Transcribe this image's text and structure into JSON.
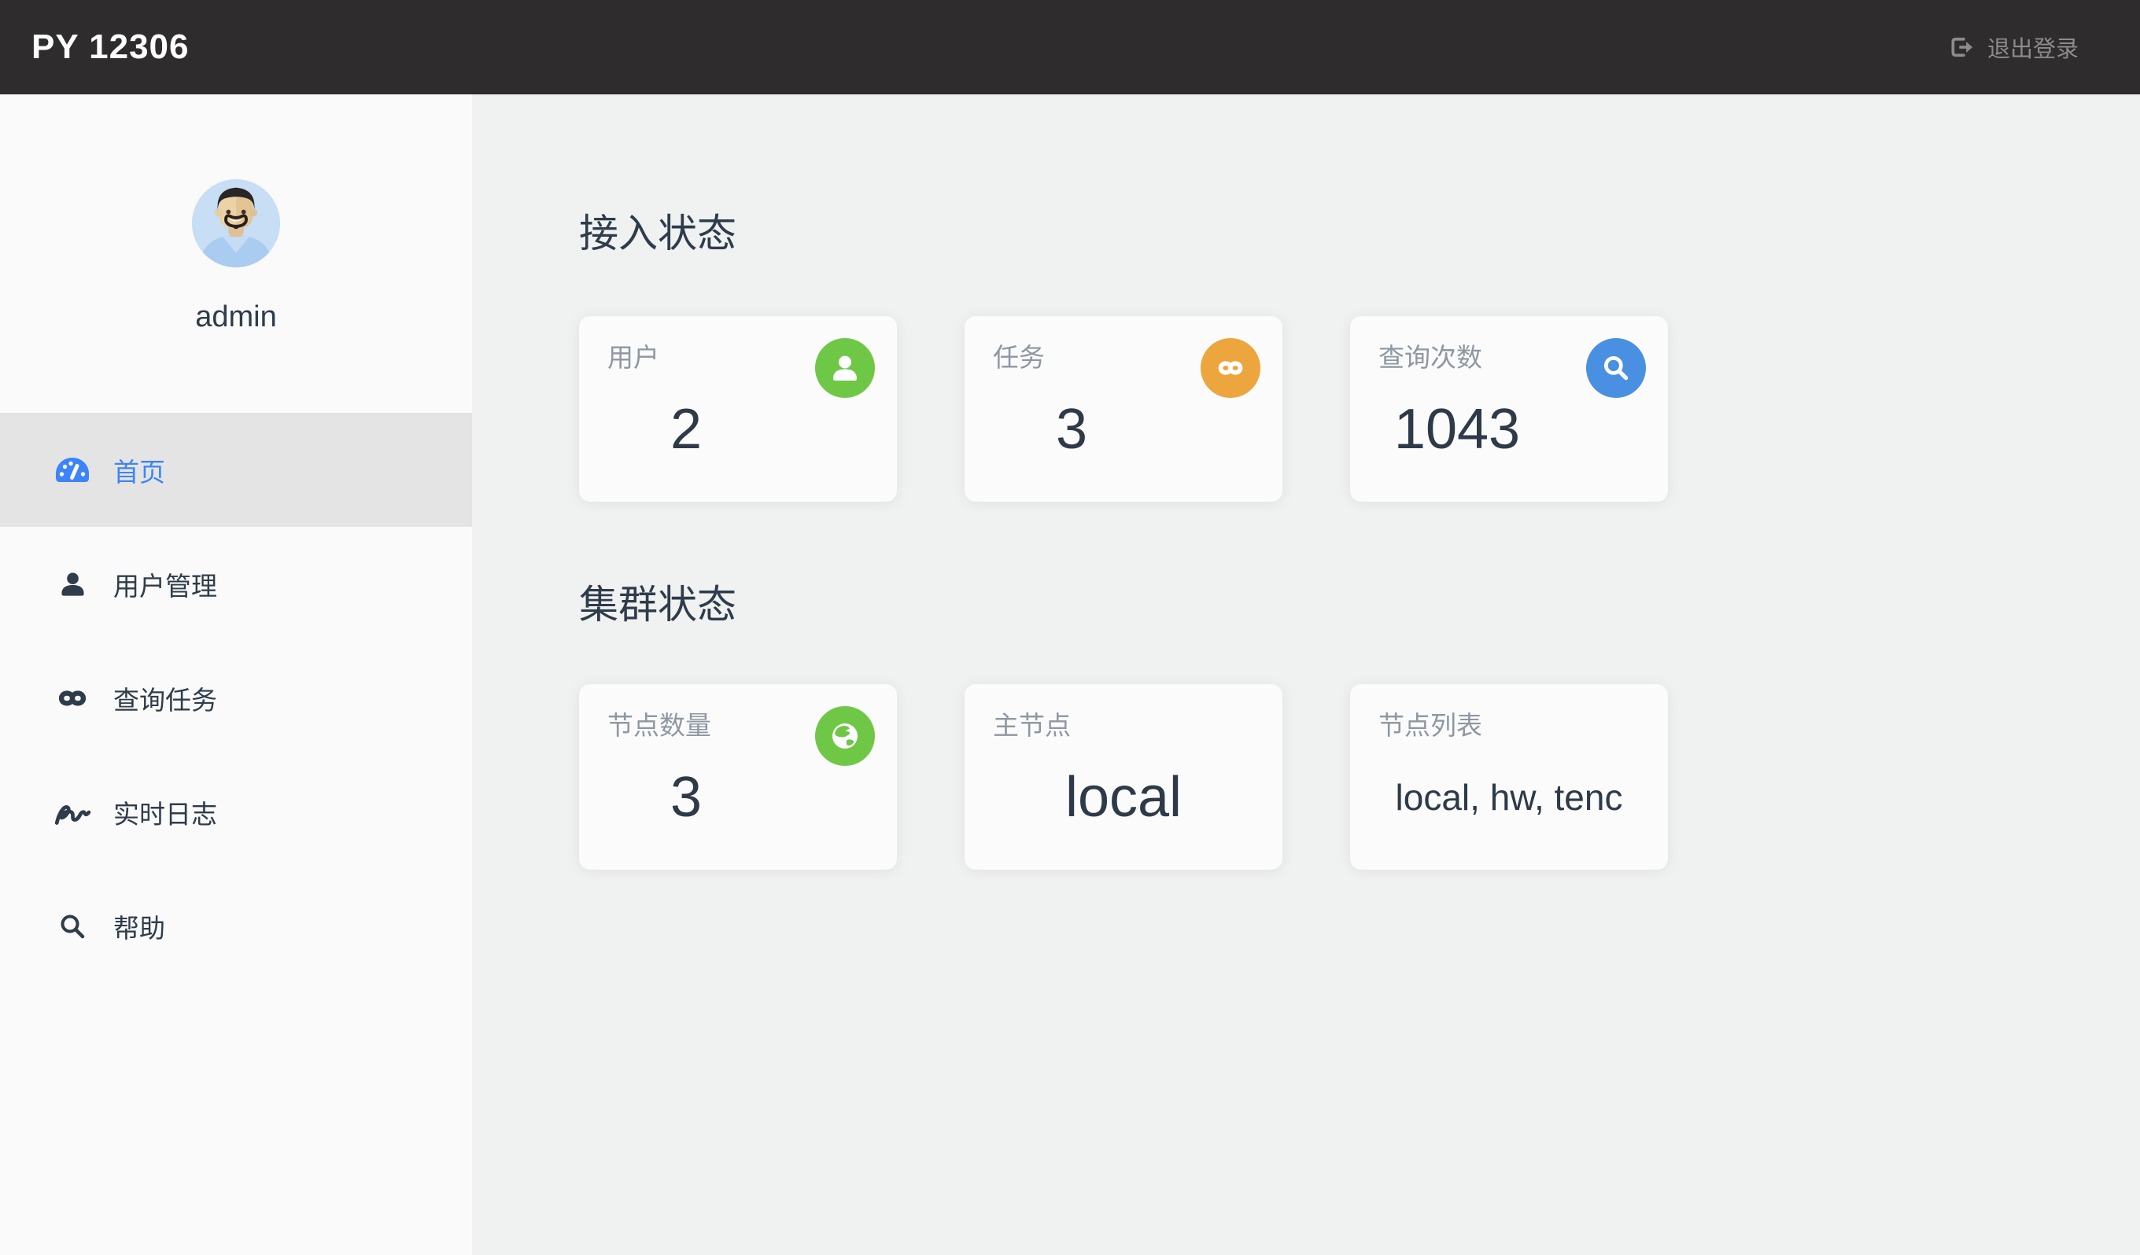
{
  "header": {
    "title": "PY 12306",
    "logout": {
      "label": "退出登录",
      "icon": "sign-out-icon"
    }
  },
  "sidebar": {
    "avatar": {
      "icon": "user-avatar",
      "username": "admin"
    },
    "menu": [
      {
        "label": "首页",
        "icon": "dashboard-gauge-icon",
        "active": true
      },
      {
        "label": "用户管理",
        "icon": "user-icon",
        "active": false
      },
      {
        "label": "查询任务",
        "icon": "infinity-icon",
        "active": false
      },
      {
        "label": "实时日志",
        "icon": "wave-icon",
        "active": false
      },
      {
        "label": "帮助",
        "icon": "search-icon",
        "active": false
      }
    ]
  },
  "main": {
    "sections": [
      {
        "title": "接入状态",
        "cards": [
          {
            "label": "用户",
            "value": "2",
            "icon": "user-icon",
            "icon_bg": "#6ec846"
          },
          {
            "label": "任务",
            "value": "3",
            "icon": "infinity-icon",
            "icon_bg": "#eda53d"
          },
          {
            "label": "查询次数",
            "value": "1043",
            "icon": "search-icon",
            "icon_bg": "#4a90e2"
          }
        ]
      },
      {
        "title": "集群状态",
        "cards": [
          {
            "label": "节点数量",
            "value": "3",
            "icon": "globe-icon",
            "icon_bg": "#6ec846"
          },
          {
            "label": "主节点",
            "value": "local"
          },
          {
            "label": "节点列表",
            "value": "local, hw, tenc"
          }
        ]
      }
    ]
  },
  "colors": {
    "header_bg": "#2e2c2d",
    "accent_blue": "#3d84f8",
    "success_green": "#6ec846",
    "warning_orange": "#eda53d",
    "info_blue": "#4a90e2",
    "text_dark": "#2e3c4b",
    "text_gray": "#8e97a2",
    "sidebar_bg": "#fafafa",
    "active_item_bg": "#e4e4e4",
    "main_bg": "#f0f1f1",
    "card_bg": "#fbfbfb"
  }
}
